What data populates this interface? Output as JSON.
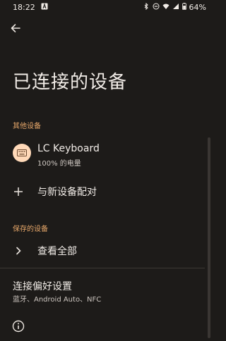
{
  "status_bar": {
    "time": "18:22",
    "battery": "64%",
    "icons": [
      "notification-a-icon",
      "bluetooth-icon",
      "do-not-disturb-icon",
      "wifi-icon",
      "signal-icon",
      "battery-icon"
    ]
  },
  "header": {
    "title": "已连接的设备"
  },
  "sections": {
    "other_devices_label": "其他设备",
    "saved_devices_label": "保存的设备"
  },
  "device": {
    "name": "LC Keyboard",
    "battery_text": "100% 的电量",
    "icon": "keyboard-icon"
  },
  "actions": {
    "pair_new": "与新设备配对",
    "see_all": "查看全部"
  },
  "preferences": {
    "title": "连接偏好设置",
    "subtitle": "蓝牙、Android Auto、NFC"
  },
  "colors": {
    "background": "#1d1b19",
    "accent": "#e8a86a",
    "device_icon_bg": "#ffd9b8"
  }
}
